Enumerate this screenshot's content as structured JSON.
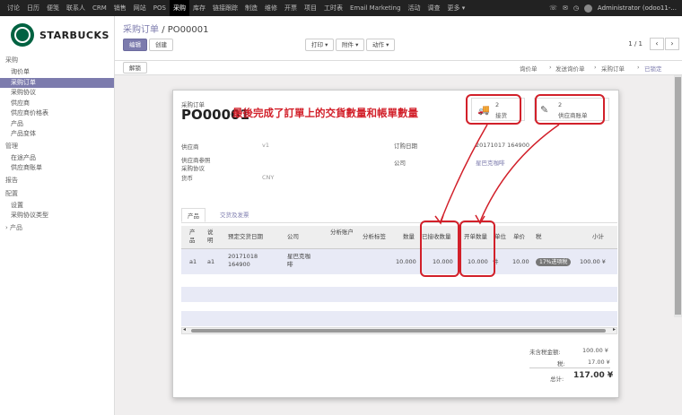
{
  "topnav": {
    "items": [
      "讨论",
      "日历",
      "便笺",
      "联系人",
      "CRM",
      "销售",
      "网站",
      "POS",
      "采购",
      "库存",
      "链接跟踪",
      "制造",
      "维修",
      "开票",
      "项目",
      "工时表",
      "Email Marketing",
      "活动",
      "调查",
      "更多 ▾"
    ],
    "active_index": 8,
    "user": "Administrator (odoo11-..."
  },
  "sidebar": {
    "brand": "STARBUCKS",
    "sections": [
      {
        "label": "采购",
        "items": [
          "询价单",
          "采购订单",
          "采购协议",
          "供应商",
          "供应商价格表",
          "产品",
          "产品变体"
        ]
      },
      {
        "label": "管理",
        "items": [
          "在途产品",
          "供应商账单"
        ]
      },
      {
        "label": "报告",
        "items": []
      },
      {
        "label": "配置",
        "items": [
          "设置",
          "采购协议类型"
        ]
      },
      {
        "label": "› 产品",
        "items": []
      }
    ],
    "active_item": "采购订单"
  },
  "control": {
    "breadcrumb_parent": "采购订单",
    "breadcrumb_sep": "/",
    "breadcrumb_current": "PO00001",
    "edit": "编辑",
    "create": "创建",
    "print": "打印 ▾",
    "attach": "附件 ▾",
    "action": "动作 ▾",
    "pager": "1 / 1",
    "prev": "‹",
    "next": "›"
  },
  "statusbar": {
    "unlock": "解锁",
    "stages": [
      "询价单",
      "发送询价单",
      "采购订单",
      "已锁定"
    ],
    "current": "已锁定"
  },
  "form": {
    "doc_label": "采购订单",
    "doc_name": "PO00001",
    "annotation": "最後完成了訂單上的交貨數量和帳單數量",
    "smart_buttons": [
      {
        "icon": "truck-icon",
        "glyph": "🚚",
        "count": "2",
        "label": "接货"
      },
      {
        "icon": "pencil-square-icon",
        "glyph": "✎",
        "count": "2",
        "label": "供应商账单"
      }
    ],
    "fields_left": [
      {
        "label": "供应商",
        "value": "v1"
      },
      {
        "label": "供应商参照",
        "value": ""
      },
      {
        "label": "采购协议",
        "value": ""
      },
      {
        "label": "货币",
        "value": "CNY"
      }
    ],
    "fields_right": [
      {
        "label": "订购日期",
        "value": "20171017 164900"
      },
      {
        "label": "公司",
        "value": "星巴克咖啡"
      }
    ],
    "tabs": [
      "产品",
      "交货及发票"
    ],
    "columns": [
      "产品",
      "说明",
      "预定交货日期",
      "公司",
      "分析账户",
      "分析标签",
      "数量",
      "已接收数量",
      "开单数量",
      "单位",
      "单价",
      "税",
      "小计"
    ],
    "rows": [
      {
        "product": "a1",
        "desc": "a1",
        "date": "20171018 164900",
        "company": "星巴克咖啡",
        "account": "",
        "tags": "",
        "qty": "10.000",
        "received": "10.000",
        "billed": "10.000",
        "uom": "件",
        "price": "10.00",
        "tax": "17%进项税",
        "subtotal": "100.00 ¥"
      }
    ],
    "totals": [
      {
        "label": "未含税金额:",
        "value": "100.00 ¥"
      },
      {
        "label": "税:",
        "value": "17.00 ¥"
      },
      {
        "label": "总计:",
        "value": "117.00 ¥"
      }
    ]
  },
  "colors": {
    "accent": "#7c7bad",
    "annotation": "#d2202a",
    "brand": "#006241"
  }
}
